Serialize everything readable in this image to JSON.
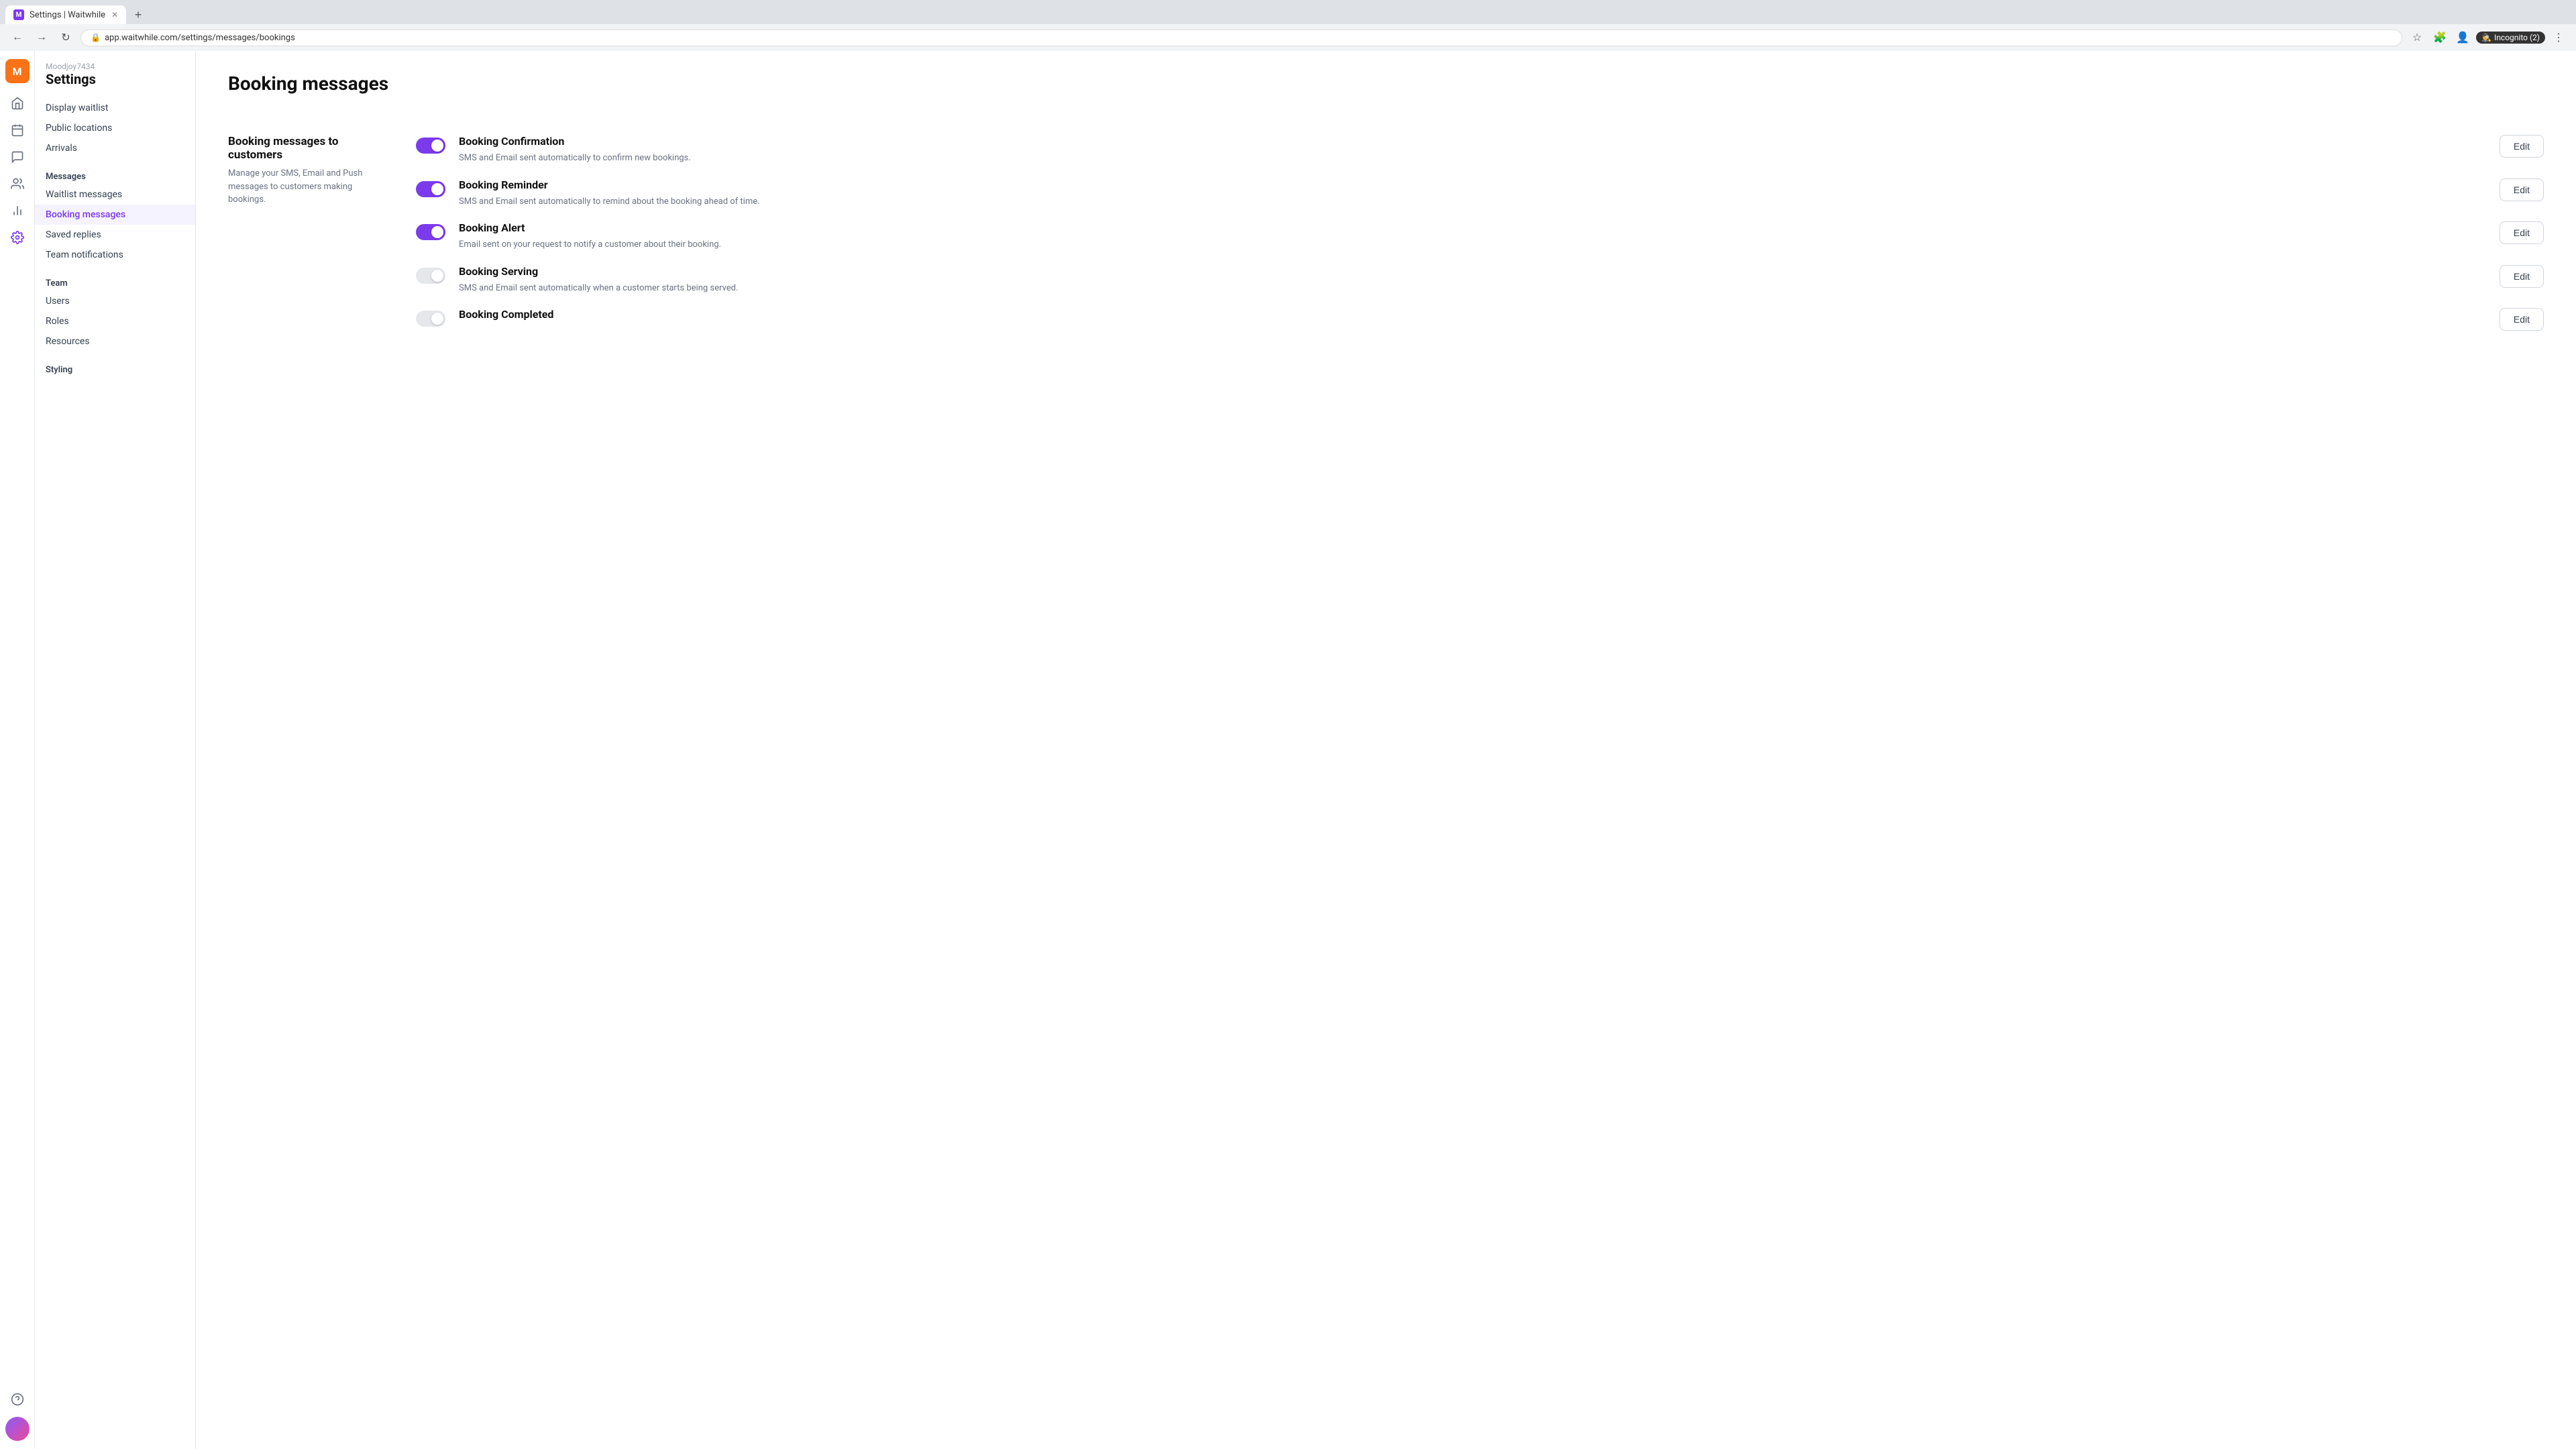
{
  "browser": {
    "tab_title": "Settings | Waitwhile",
    "tab_favicon": "M",
    "url": "app.waitwhile.com/settings/messages/bookings",
    "incognito_label": "Incognito (2)"
  },
  "sidebar": {
    "username": "Moodjoy7434",
    "title": "Settings",
    "nav_items_top": [
      {
        "label": "Display waitlist"
      },
      {
        "label": "Public locations"
      },
      {
        "label": "Arrivals"
      }
    ],
    "section_messages": {
      "label": "Messages",
      "items": [
        {
          "label": "Waitlist messages"
        },
        {
          "label": "Booking messages",
          "active": true
        },
        {
          "label": "Saved replies"
        },
        {
          "label": "Team notifications"
        }
      ]
    },
    "section_team": {
      "label": "Team",
      "items": [
        {
          "label": "Users"
        },
        {
          "label": "Roles"
        },
        {
          "label": "Resources"
        }
      ]
    },
    "section_styling": {
      "label": "Styling"
    }
  },
  "main": {
    "page_title": "Booking messages",
    "left_col_title": "Booking messages to customers",
    "left_col_desc": "Manage your SMS, Email and Push messages to customers making bookings.",
    "messages": [
      {
        "title": "Booking Confirmation",
        "description": "SMS and Email sent automatically to confirm new bookings.",
        "toggle_on": true,
        "edit_label": "Edit"
      },
      {
        "title": "Booking Reminder",
        "description": "SMS and Email sent automatically to remind about the booking ahead of time.",
        "toggle_on": true,
        "edit_label": "Edit"
      },
      {
        "title": "Booking Alert",
        "description": "Email sent on your request to notify a customer about their booking.",
        "toggle_on": true,
        "edit_label": "Edit"
      },
      {
        "title": "Booking Serving",
        "description": "SMS and Email sent automatically when a customer starts being served.",
        "toggle_on": false,
        "edit_label": "Edit"
      },
      {
        "title": "Booking Completed",
        "description": "",
        "toggle_on": false,
        "edit_label": "Edit"
      }
    ]
  }
}
